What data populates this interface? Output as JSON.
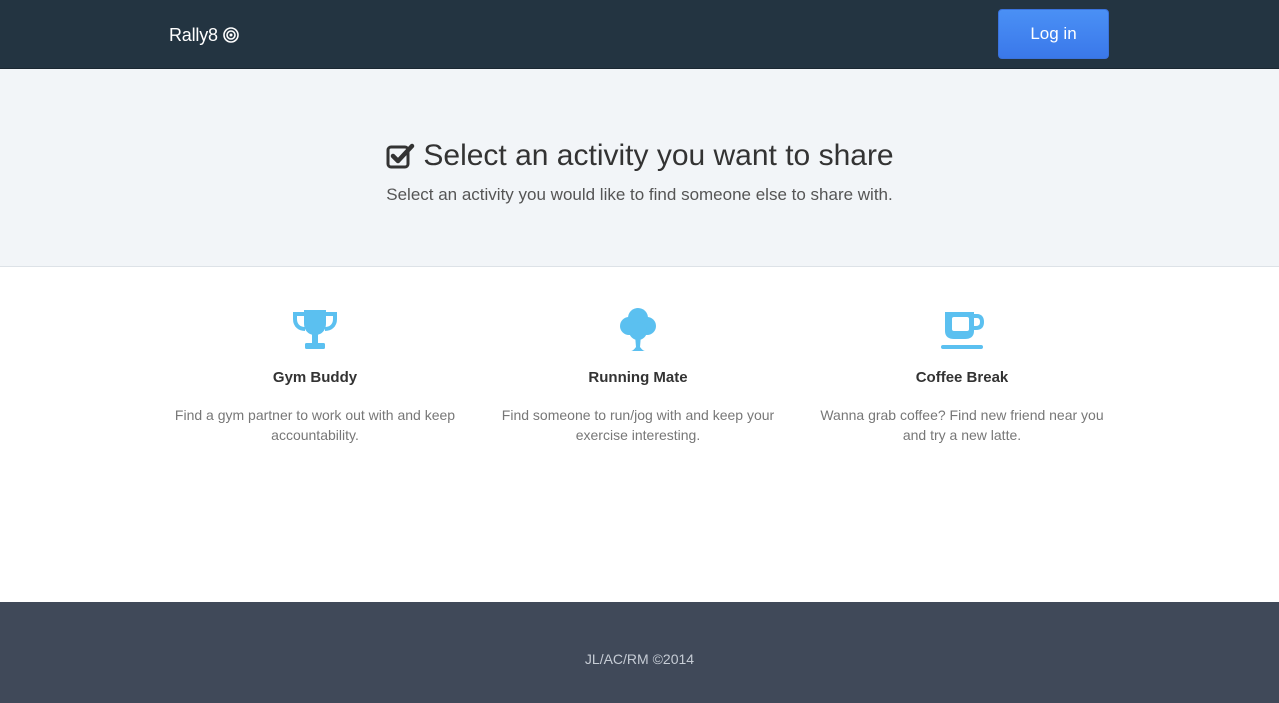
{
  "navbar": {
    "brand": "Rally8",
    "brand_icon": "target-icon",
    "login_label": "Log in",
    "login_color": "#4285f4"
  },
  "hero": {
    "icon": "check-square-icon",
    "title": "Select an activity you want to share",
    "subtitle": "Select an activity you would like to find someone else to share with."
  },
  "activities": [
    {
      "icon": "trophy-icon",
      "title": "Gym Buddy",
      "description": "Find a gym partner to work out with and keep accountability."
    },
    {
      "icon": "tree-icon",
      "title": "Running Mate",
      "description": "Find someone to run/jog with and keep your exercise interesting."
    },
    {
      "icon": "coffee-cup-icon",
      "title": "Coffee Break",
      "description": "Wanna grab coffee? Find new friend near you and try a new latte."
    }
  ],
  "icon_color": "#5bc0f0",
  "footer": {
    "text": "JL/AC/RM ©2014"
  }
}
